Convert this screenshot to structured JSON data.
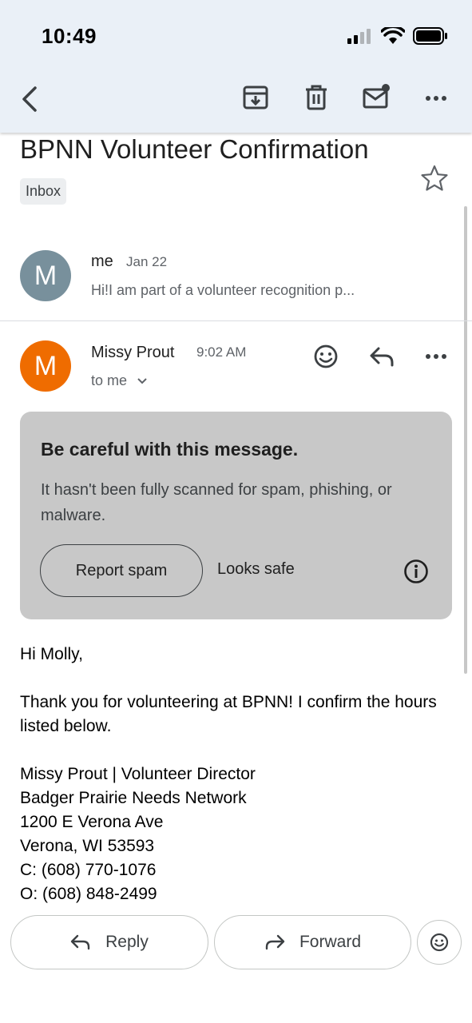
{
  "status_bar": {
    "time": "10:49"
  },
  "toolbar": {
    "icons": [
      "back-arrow-icon",
      "archive-icon",
      "trash-icon",
      "mark-unread-icon",
      "more-icon"
    ]
  },
  "email": {
    "subject": "BPNN Volunteer Confirmation",
    "label": "Inbox"
  },
  "thread": [
    {
      "avatar_letter": "M",
      "avatar_color": "#78909c",
      "sender": "me",
      "date": "Jan 22",
      "snippet": "Hi!I am part of a volunteer recognition p..."
    },
    {
      "avatar_letter": "M",
      "avatar_color": "#ef6c00",
      "sender": "Missy Prout",
      "time": "9:02 AM",
      "recipient": "to me"
    }
  ],
  "warning": {
    "title": "Be careful with this message.",
    "text": "It hasn't been fully scanned for spam, phishing, or malware.",
    "report_label": "Report spam",
    "safe_label": "Looks safe"
  },
  "body": {
    "greeting": "Hi Molly,",
    "paragraph": "Thank you for volunteering at BPNN! I confirm the hours listed below.",
    "signature": [
      "Missy Prout | Volunteer Director",
      "Badger Prairie Needs Network",
      "1200 E Verona Ave",
      "Verona, WI 53593",
      "C: (608) 770-1076",
      "O: (608) 848-2499"
    ]
  },
  "actions": {
    "reply_label": "Reply",
    "forward_label": "Forward"
  }
}
